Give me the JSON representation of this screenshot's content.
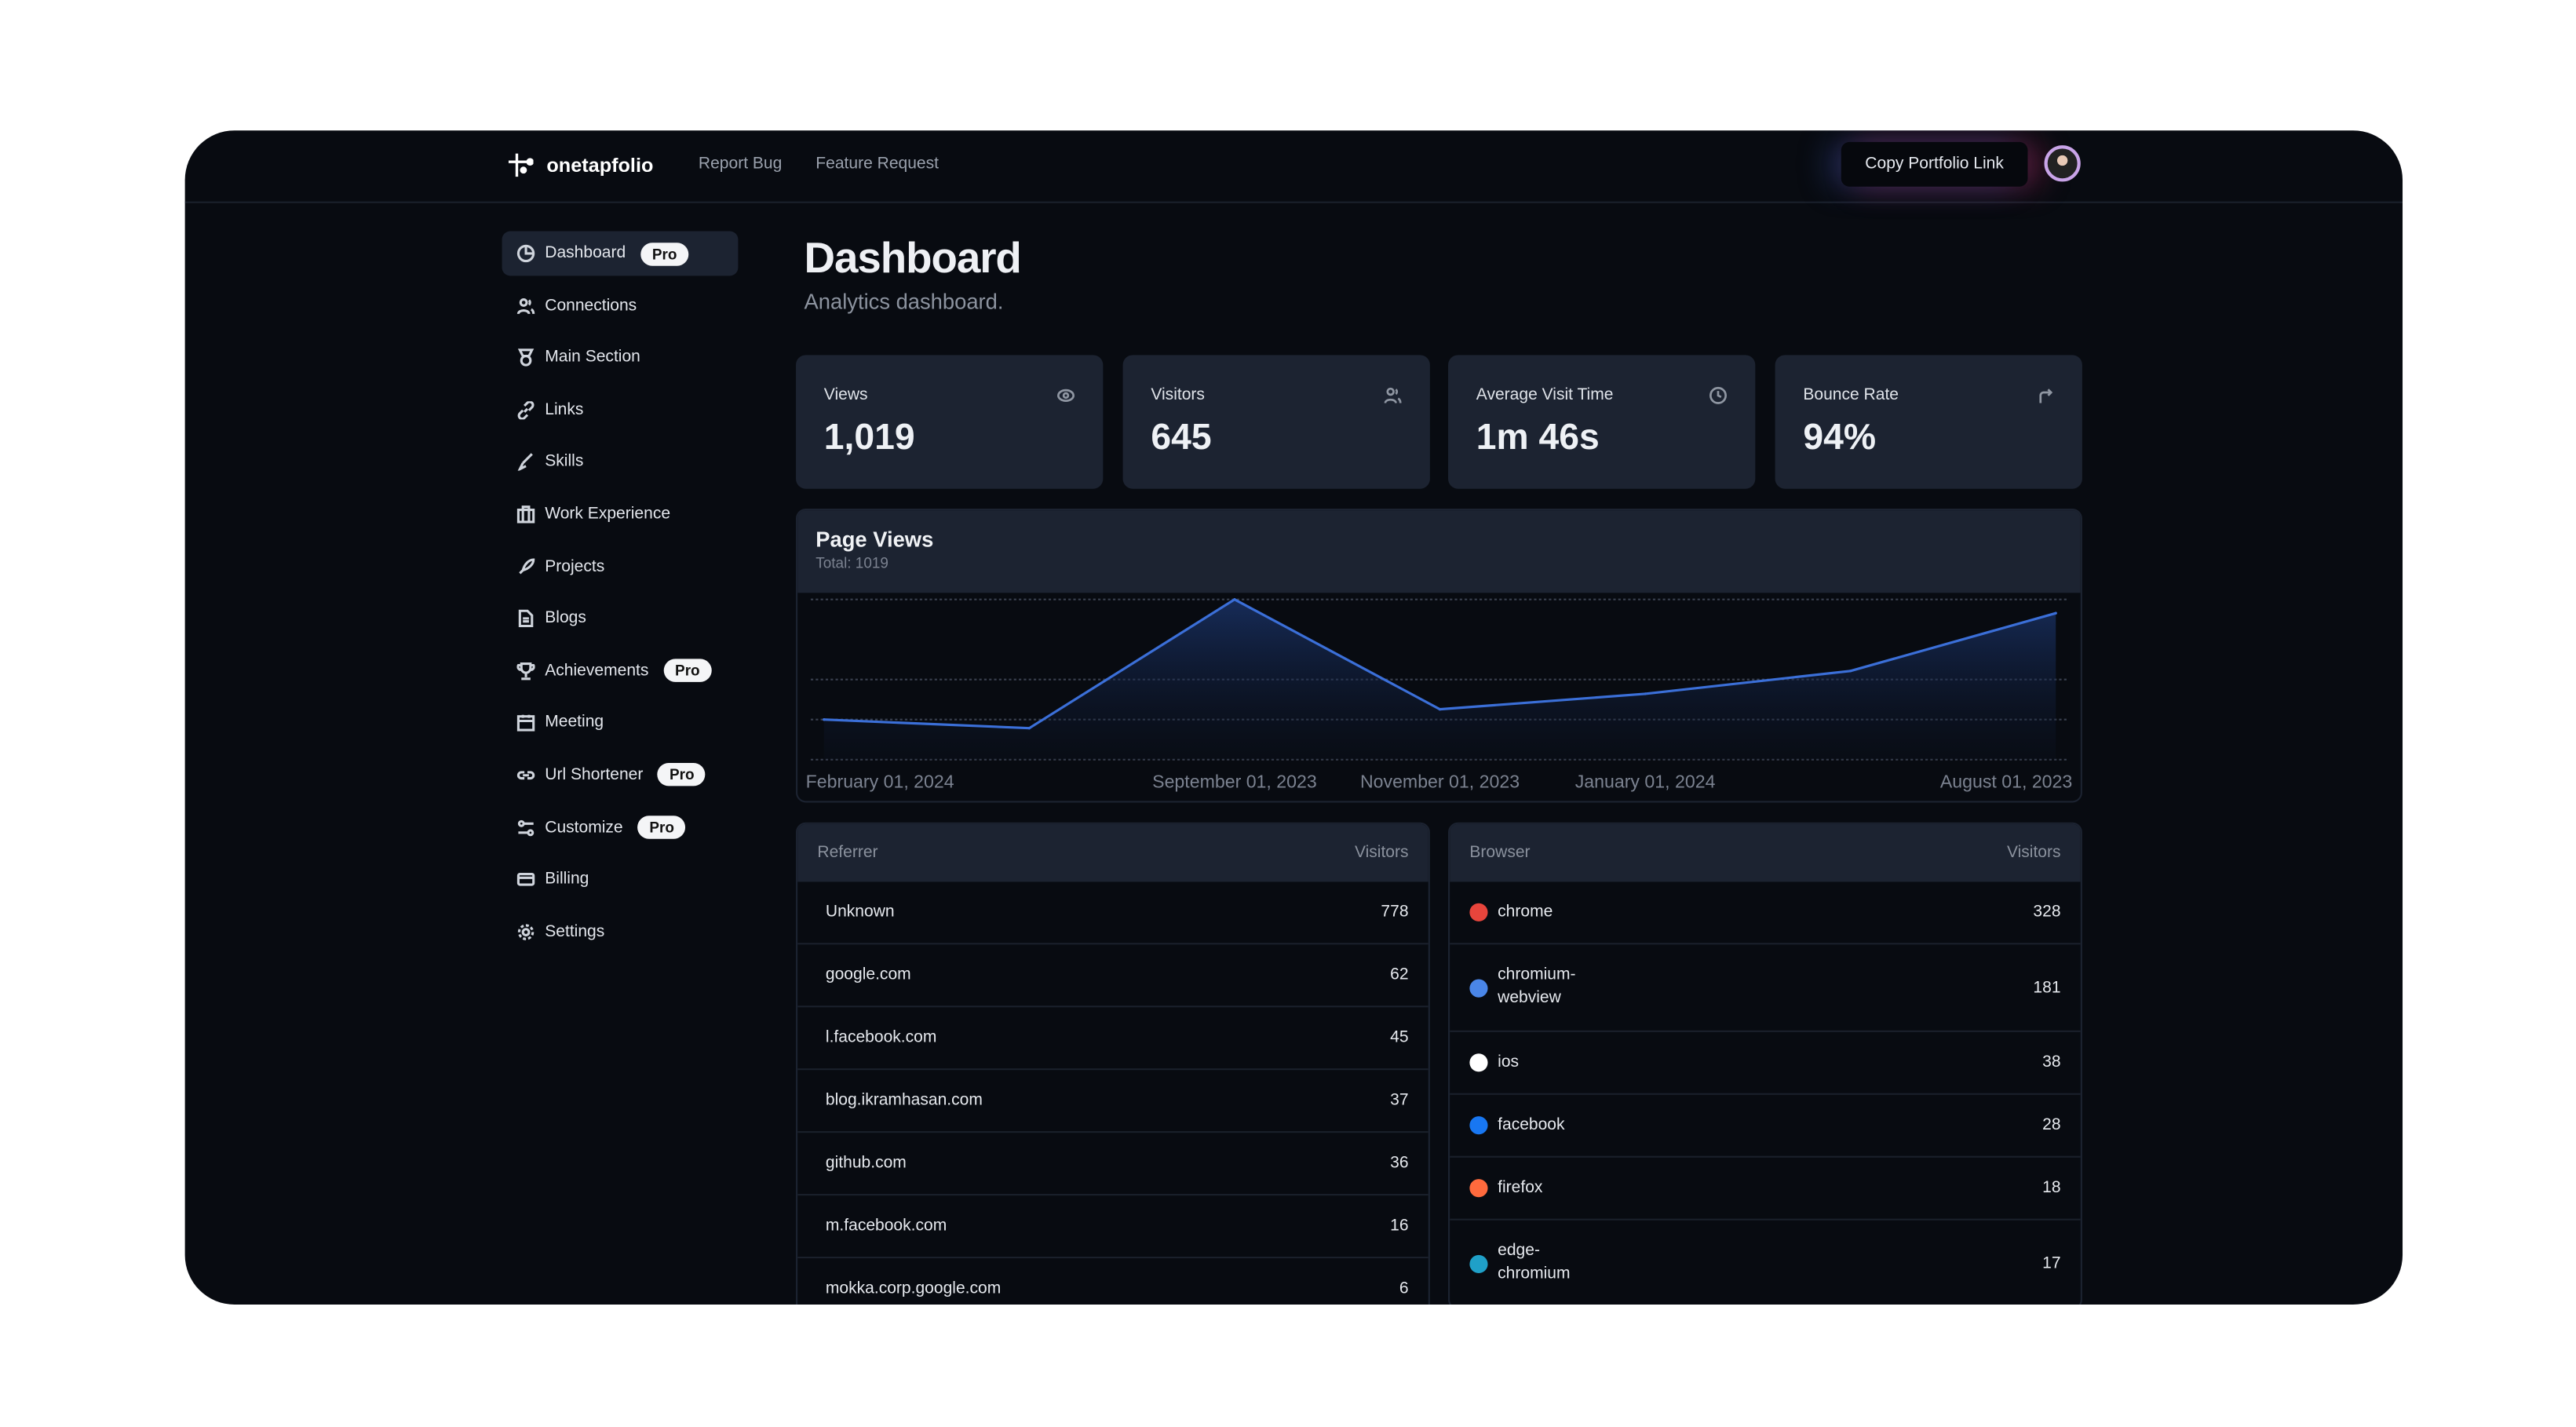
{
  "header": {
    "brand": "onetapfolio",
    "links": [
      "Report Bug",
      "Feature Request"
    ],
    "copy_button": "Copy Portfolio Link"
  },
  "sidebar": {
    "items": [
      {
        "label": "Dashboard",
        "badge": "Pro",
        "icon": "pie-chart-icon",
        "active": true
      },
      {
        "label": "Connections",
        "icon": "users-icon"
      },
      {
        "label": "Main Section",
        "icon": "medal-icon"
      },
      {
        "label": "Links",
        "icon": "link-icon"
      },
      {
        "label": "Skills",
        "icon": "brush-icon"
      },
      {
        "label": "Work Experience",
        "icon": "briefcase-icon"
      },
      {
        "label": "Projects",
        "icon": "rocket-icon"
      },
      {
        "label": "Blogs",
        "icon": "file-text-icon"
      },
      {
        "label": "Achievements",
        "badge": "Pro",
        "icon": "trophy-icon"
      },
      {
        "label": "Meeting",
        "icon": "calendar-icon"
      },
      {
        "label": "Url Shortener",
        "badge": "Pro",
        "icon": "link-2-icon"
      },
      {
        "label": "Customize",
        "badge": "Pro",
        "icon": "sliders-icon"
      },
      {
        "label": "Billing",
        "icon": "credit-card-icon"
      },
      {
        "label": "Settings",
        "icon": "gear-icon"
      }
    ]
  },
  "page": {
    "title": "Dashboard",
    "subtitle": "Analytics dashboard."
  },
  "stats": [
    {
      "label": "Views",
      "value": "1,019",
      "icon": "eye-icon"
    },
    {
      "label": "Visitors",
      "value": "645",
      "icon": "users-icon"
    },
    {
      "label": "Average Visit Time",
      "value": "1m 46s",
      "icon": "clock-icon"
    },
    {
      "label": "Bounce Rate",
      "value": "94%",
      "icon": "redirect-arrow-icon"
    }
  ],
  "chart_data": {
    "type": "area",
    "title": "Page Views",
    "subtitle": "Total: 1019",
    "categories": [
      "February 01, 2024",
      "",
      "September 01, 2023",
      "November 01, 2023",
      "January 01, 2024",
      "",
      "August 01, 2023"
    ],
    "values": [
      70,
      55,
      280,
      88,
      115,
      155,
      256
    ],
    "ylim": [
      0,
      280
    ],
    "grid": true,
    "color": "#3b6fd8"
  },
  "referrers": {
    "headers": [
      "Referrer",
      "Visitors"
    ],
    "rows": [
      [
        "Unknown",
        "778"
      ],
      [
        "google.com",
        "62"
      ],
      [
        "l.facebook.com",
        "45"
      ],
      [
        "blog.ikramhasan.com",
        "37"
      ],
      [
        "github.com",
        "36"
      ],
      [
        "m.facebook.com",
        "16"
      ],
      [
        "mokka.corp.google.com",
        "6"
      ]
    ]
  },
  "browsers": {
    "headers": [
      "Browser",
      "Visitors"
    ],
    "rows": [
      {
        "name": "chrome",
        "value": "328",
        "color": "#e8453c"
      },
      {
        "name": "chromium-webview",
        "value": "181",
        "color": "#4a86e8"
      },
      {
        "name": "ios",
        "value": "38",
        "color": "#ffffff"
      },
      {
        "name": "facebook",
        "value": "28",
        "color": "#1877f2"
      },
      {
        "name": "firefox",
        "value": "18",
        "color": "#ff6a3d"
      },
      {
        "name": "edge-chromium",
        "value": "17",
        "color": "#1fa0c8"
      }
    ]
  }
}
